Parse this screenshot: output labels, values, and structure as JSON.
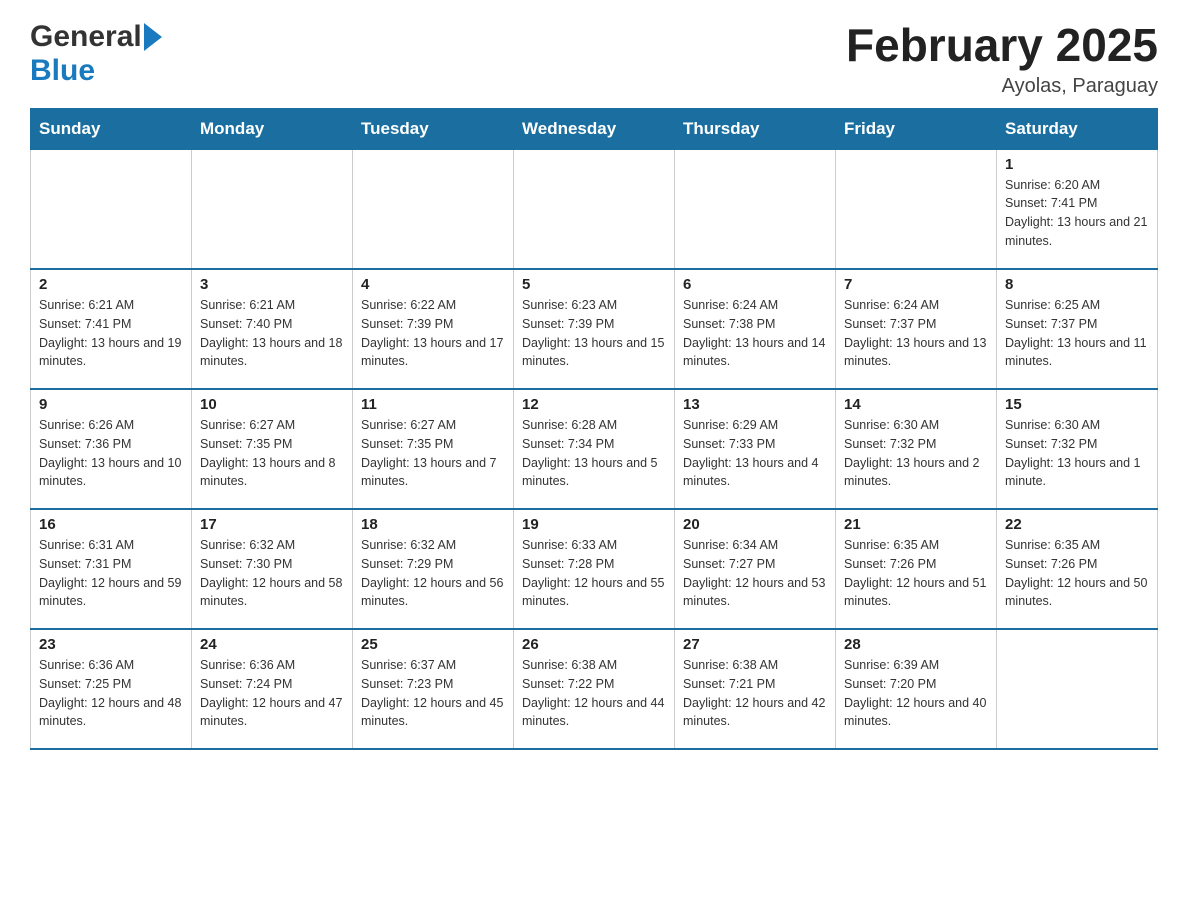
{
  "header": {
    "logo_general": "General",
    "logo_blue": "Blue",
    "month_title": "February 2025",
    "location": "Ayolas, Paraguay"
  },
  "weekdays": [
    "Sunday",
    "Monday",
    "Tuesday",
    "Wednesday",
    "Thursday",
    "Friday",
    "Saturday"
  ],
  "weeks": [
    [
      {
        "day": "",
        "info": ""
      },
      {
        "day": "",
        "info": ""
      },
      {
        "day": "",
        "info": ""
      },
      {
        "day": "",
        "info": ""
      },
      {
        "day": "",
        "info": ""
      },
      {
        "day": "",
        "info": ""
      },
      {
        "day": "1",
        "info": "Sunrise: 6:20 AM\nSunset: 7:41 PM\nDaylight: 13 hours and 21 minutes."
      }
    ],
    [
      {
        "day": "2",
        "info": "Sunrise: 6:21 AM\nSunset: 7:41 PM\nDaylight: 13 hours and 19 minutes."
      },
      {
        "day": "3",
        "info": "Sunrise: 6:21 AM\nSunset: 7:40 PM\nDaylight: 13 hours and 18 minutes."
      },
      {
        "day": "4",
        "info": "Sunrise: 6:22 AM\nSunset: 7:39 PM\nDaylight: 13 hours and 17 minutes."
      },
      {
        "day": "5",
        "info": "Sunrise: 6:23 AM\nSunset: 7:39 PM\nDaylight: 13 hours and 15 minutes."
      },
      {
        "day": "6",
        "info": "Sunrise: 6:24 AM\nSunset: 7:38 PM\nDaylight: 13 hours and 14 minutes."
      },
      {
        "day": "7",
        "info": "Sunrise: 6:24 AM\nSunset: 7:37 PM\nDaylight: 13 hours and 13 minutes."
      },
      {
        "day": "8",
        "info": "Sunrise: 6:25 AM\nSunset: 7:37 PM\nDaylight: 13 hours and 11 minutes."
      }
    ],
    [
      {
        "day": "9",
        "info": "Sunrise: 6:26 AM\nSunset: 7:36 PM\nDaylight: 13 hours and 10 minutes."
      },
      {
        "day": "10",
        "info": "Sunrise: 6:27 AM\nSunset: 7:35 PM\nDaylight: 13 hours and 8 minutes."
      },
      {
        "day": "11",
        "info": "Sunrise: 6:27 AM\nSunset: 7:35 PM\nDaylight: 13 hours and 7 minutes."
      },
      {
        "day": "12",
        "info": "Sunrise: 6:28 AM\nSunset: 7:34 PM\nDaylight: 13 hours and 5 minutes."
      },
      {
        "day": "13",
        "info": "Sunrise: 6:29 AM\nSunset: 7:33 PM\nDaylight: 13 hours and 4 minutes."
      },
      {
        "day": "14",
        "info": "Sunrise: 6:30 AM\nSunset: 7:32 PM\nDaylight: 13 hours and 2 minutes."
      },
      {
        "day": "15",
        "info": "Sunrise: 6:30 AM\nSunset: 7:32 PM\nDaylight: 13 hours and 1 minute."
      }
    ],
    [
      {
        "day": "16",
        "info": "Sunrise: 6:31 AM\nSunset: 7:31 PM\nDaylight: 12 hours and 59 minutes."
      },
      {
        "day": "17",
        "info": "Sunrise: 6:32 AM\nSunset: 7:30 PM\nDaylight: 12 hours and 58 minutes."
      },
      {
        "day": "18",
        "info": "Sunrise: 6:32 AM\nSunset: 7:29 PM\nDaylight: 12 hours and 56 minutes."
      },
      {
        "day": "19",
        "info": "Sunrise: 6:33 AM\nSunset: 7:28 PM\nDaylight: 12 hours and 55 minutes."
      },
      {
        "day": "20",
        "info": "Sunrise: 6:34 AM\nSunset: 7:27 PM\nDaylight: 12 hours and 53 minutes."
      },
      {
        "day": "21",
        "info": "Sunrise: 6:35 AM\nSunset: 7:26 PM\nDaylight: 12 hours and 51 minutes."
      },
      {
        "day": "22",
        "info": "Sunrise: 6:35 AM\nSunset: 7:26 PM\nDaylight: 12 hours and 50 minutes."
      }
    ],
    [
      {
        "day": "23",
        "info": "Sunrise: 6:36 AM\nSunset: 7:25 PM\nDaylight: 12 hours and 48 minutes."
      },
      {
        "day": "24",
        "info": "Sunrise: 6:36 AM\nSunset: 7:24 PM\nDaylight: 12 hours and 47 minutes."
      },
      {
        "day": "25",
        "info": "Sunrise: 6:37 AM\nSunset: 7:23 PM\nDaylight: 12 hours and 45 minutes."
      },
      {
        "day": "26",
        "info": "Sunrise: 6:38 AM\nSunset: 7:22 PM\nDaylight: 12 hours and 44 minutes."
      },
      {
        "day": "27",
        "info": "Sunrise: 6:38 AM\nSunset: 7:21 PM\nDaylight: 12 hours and 42 minutes."
      },
      {
        "day": "28",
        "info": "Sunrise: 6:39 AM\nSunset: 7:20 PM\nDaylight: 12 hours and 40 minutes."
      },
      {
        "day": "",
        "info": ""
      }
    ]
  ]
}
